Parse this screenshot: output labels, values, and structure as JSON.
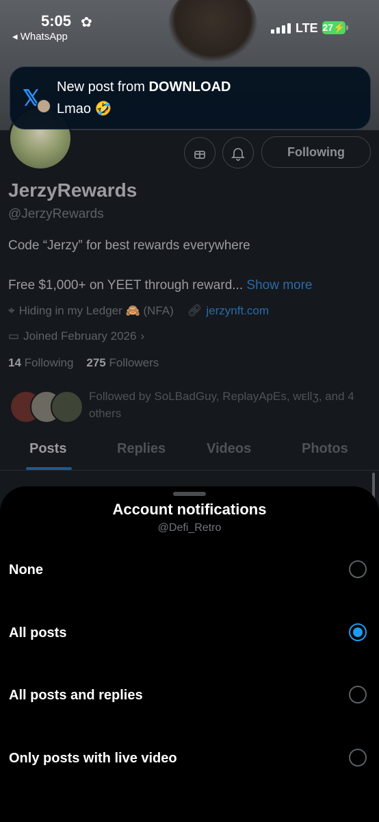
{
  "status_bar": {
    "time": "5:05",
    "back_app": "◂ WhatsApp",
    "network": "LTE",
    "battery": "27"
  },
  "notification": {
    "title_prefix": "New post from ",
    "title_author": "DOWNLOAD",
    "body": "Lmao 🤣"
  },
  "profile": {
    "name": "JerzyRewards",
    "handle": "@JerzyRewards",
    "bio_line1": "Code “Jerzy” for best rewards everywhere",
    "bio_line2": "Free $1,000+ on YEET through reward...",
    "show_more": "Show more",
    "location": "Hiding in my Ledger 🙈 (NFA)",
    "website": "jerzynft.com",
    "joined": "Joined February 2026",
    "following_count": "14",
    "following_label": "Following",
    "followers_count": "275",
    "followers_label": "Followers",
    "followed_by": "Followed by SoLBadGuy, ReplayApEs, wᴇllʒ, and 4 others",
    "following_button": "Following"
  },
  "tabs": [
    "Posts",
    "Replies",
    "Videos",
    "Photos"
  ],
  "sheet": {
    "title": "Account notifications",
    "subtitle": "@Defi_Retro",
    "options": [
      {
        "label": "None",
        "selected": false
      },
      {
        "label": "All posts",
        "selected": true
      },
      {
        "label": "All posts and replies",
        "selected": false
      },
      {
        "label": "Only posts with live video",
        "selected": false
      }
    ]
  },
  "colors": {
    "accent": "#1d9bf0",
    "sheet_bg": "#000000",
    "notification_bg": "#041220"
  }
}
